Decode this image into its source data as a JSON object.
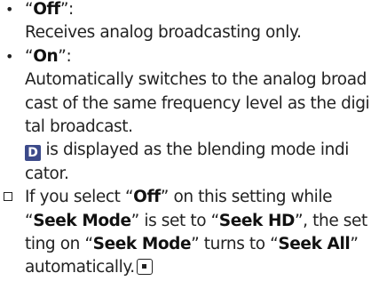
{
  "items": {
    "off": {
      "bullet": "•",
      "quote_open": "“",
      "label": "Off",
      "quote_close": "”:",
      "desc": "Receives analog broadcasting only."
    },
    "on": {
      "bullet": "•",
      "quote_open": "“",
      "label": "On",
      "quote_close": "”:",
      "desc_lines": [
        "Automatically switches to the analog broad",
        "cast of the same frequency level as the digi",
        "tal broadcast."
      ],
      "icon_glyph": "D",
      "icon_desc_line1": " is displayed as the blending mode indi",
      "icon_desc_line2": "cator."
    }
  },
  "note": {
    "line1_a": "If you select “",
    "line1_b": "Off",
    "line1_c": "” on this setting while",
    "line2_a": "“",
    "line2_b": "Seek Mode",
    "line2_c": "” is set to “",
    "line2_d": "Seek HD",
    "line2_e": "”, the set",
    "line3_a": "ting on “",
    "line3_b": "Seek Mode",
    "line3_c": "” turns to “",
    "line3_d": "Seek All",
    "line3_e": "”",
    "line4": "automatically."
  }
}
